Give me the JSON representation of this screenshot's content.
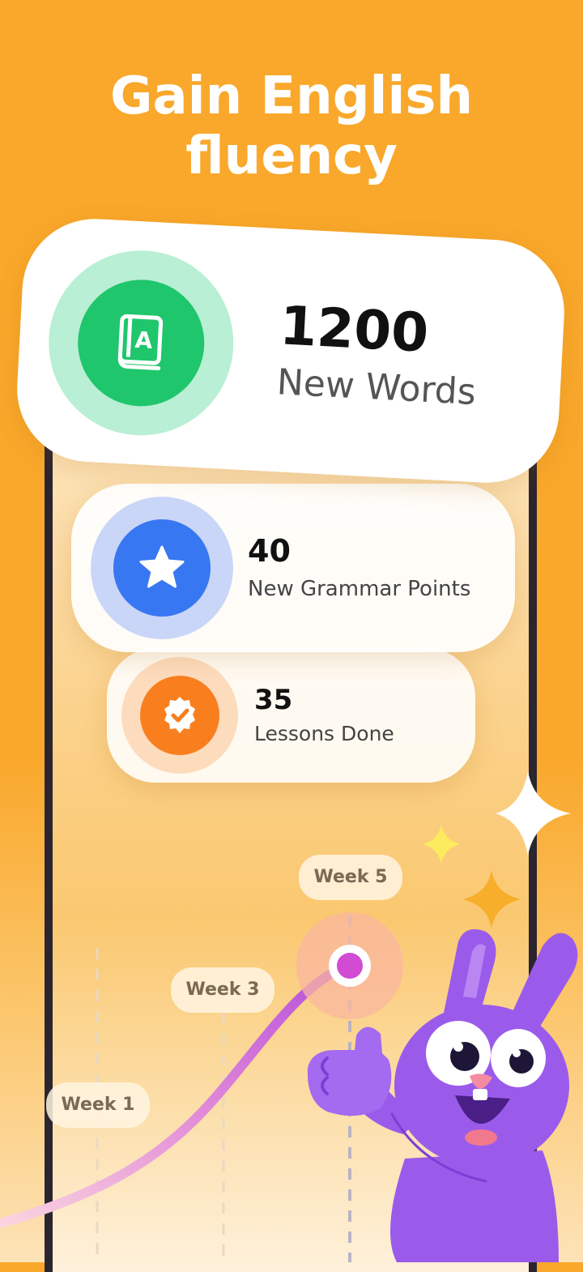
{
  "headline": {
    "line1": "Gain English",
    "line2": "fluency"
  },
  "stats": {
    "words": {
      "value": "1200",
      "label": "New Words",
      "icon": "book-icon",
      "color": "#1FC66C"
    },
    "grammar": {
      "value": "40",
      "label": "New Grammar Points",
      "icon": "star-icon",
      "color": "#3877F2"
    },
    "lessons": {
      "value": "35",
      "label": "Lessons Done",
      "icon": "badge-check-icon",
      "color": "#F97F1E"
    }
  },
  "timeline": {
    "week1": "Week 1",
    "week3": "Week 3",
    "week5": "Week 5"
  },
  "colors": {
    "background": "#F9A82B",
    "progress_line": "#C85BE0",
    "mascot": "#9B5BEA"
  },
  "mascot": {
    "icon": "rabbit-mascot"
  }
}
